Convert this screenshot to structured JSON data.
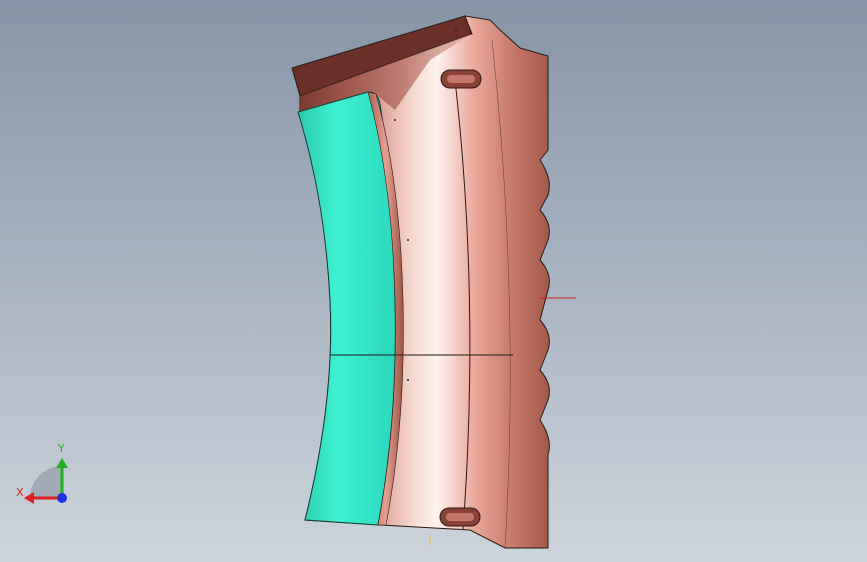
{
  "viewport": {
    "background_top": "#8794a7",
    "background_bottom": "#cdd4dc"
  },
  "model": {
    "body_color": "#d4897a",
    "highlight_color": "#fbe8e0",
    "face_color": "#33e6c8",
    "edge_color": "#2a1a16"
  },
  "triad": {
    "x_label": "X",
    "y_label": "Y",
    "x_color": "#e02020",
    "y_color": "#20b020",
    "z_color": "#2030e0"
  }
}
